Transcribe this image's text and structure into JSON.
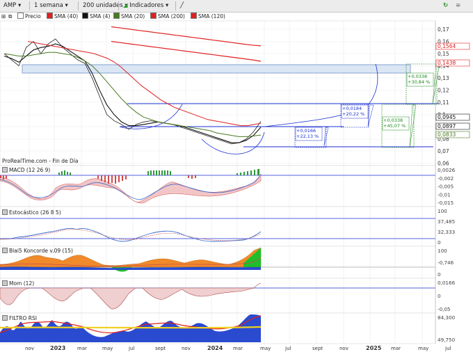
{
  "toolbar": {
    "symbol": "AMP",
    "period": "1 semana",
    "units": "200 unidades",
    "indicators": "Indicadores"
  },
  "legend": [
    {
      "label": "Precio",
      "color": "#ffffff"
    },
    {
      "label": "SMA (40)",
      "color": "#e02020"
    },
    {
      "label": "SMA (4)",
      "color": "#111111"
    },
    {
      "label": "SMA (20)",
      "color": "#4a7a20"
    },
    {
      "label": "SMA (200)",
      "color": "#e02020"
    },
    {
      "label": "SMA (120)",
      "color": "#e02020"
    }
  ],
  "watermark": "ProRealTime.com - Fin de Día",
  "price_axis": [
    "0,17",
    "0,16",
    "0,15",
    "0,14",
    "0,13",
    "0,12",
    "0,11",
    "0,1",
    "0,09",
    "0,08",
    "0,07",
    "0,06"
  ],
  "price_tags": [
    {
      "text": "0,1564",
      "color": "#e02020"
    },
    {
      "text": "0,1438",
      "color": "#e02020"
    },
    {
      "text": "0,0945",
      "color": "#111111"
    },
    {
      "text": "0,0897",
      "color": "#111111"
    },
    {
      "text": "0,0833",
      "color": "#4a7a20"
    }
  ],
  "annotations": [
    {
      "text": "+0,0166\n+22,13 %",
      "color": "#1a2fd0"
    },
    {
      "text": "+0,0184\n+20,22 %",
      "color": "#1a2fd0"
    },
    {
      "text": "+0,0338\n+45,07 %",
      "color": "#1a8a1a"
    },
    {
      "text": "+0,0338\n+30,84 %",
      "color": "#1a8a1a"
    }
  ],
  "panels": [
    {
      "title": "MACD (12 26 9)",
      "axis": [
        "0,0026",
        "-0,002",
        "-0,005",
        "-0,01",
        "-0,015"
      ]
    },
    {
      "title": "Estocástico (26 8 5)",
      "axis": [
        "100",
        "37,485",
        "32,333",
        "0"
      ]
    },
    {
      "title": "Blai5 Koncorde v.09 (15)",
      "axis": [
        "100",
        "-0,746",
        "0"
      ]
    },
    {
      "title": "Mom (12)",
      "axis": [
        "0,0166",
        "0",
        "-0,05"
      ]
    },
    {
      "title": "FILTRO RSI",
      "axis": [
        "84,300",
        "49,750"
      ]
    }
  ],
  "time_axis": [
    "nov",
    "2023",
    "mar",
    "may",
    "jul",
    "sept",
    "nov",
    "2024",
    "mar",
    "may",
    "jul",
    "sept",
    "nov",
    "2025",
    "mar",
    "may",
    "jul"
  ],
  "chart_data": {
    "type": "line",
    "title": "AMP",
    "xlabel": "",
    "ylabel": "",
    "ylim": [
      0.06,
      0.175
    ],
    "series": [
      {
        "name": "Precio",
        "values": [
          0.15,
          0.145,
          0.14,
          0.155,
          0.16,
          0.15,
          0.158,
          0.162,
          0.155,
          0.15,
          0.145,
          0.142,
          0.13,
          0.115,
          0.1,
          0.095,
          0.092,
          0.088,
          0.092,
          0.094,
          0.095,
          0.094,
          0.093,
          0.092,
          0.09,
          0.088,
          0.086,
          0.084,
          0.082,
          0.08,
          0.078,
          0.076,
          0.077,
          0.08,
          0.086,
          0.0945
        ]
      },
      {
        "name": "SMA (4)",
        "values": [
          0.148,
          0.146,
          0.143,
          0.148,
          0.153,
          0.155,
          0.156,
          0.158,
          0.156,
          0.152,
          0.148,
          0.144,
          0.134,
          0.12,
          0.108,
          0.1,
          0.094,
          0.091,
          0.091,
          0.092,
          0.093,
          0.094,
          0.093,
          0.092,
          0.091,
          0.089,
          0.087,
          0.085,
          0.083,
          0.081,
          0.079,
          0.077,
          0.077,
          0.079,
          0.083,
          0.0897
        ]
      },
      {
        "name": "SMA (20)",
        "values": [
          0.15,
          0.149,
          0.148,
          0.148,
          0.149,
          0.15,
          0.151,
          0.151,
          0.15,
          0.149,
          0.147,
          0.144,
          0.14,
          0.134,
          0.127,
          0.12,
          0.113,
          0.107,
          0.102,
          0.098,
          0.096,
          0.094,
          0.093,
          0.092,
          0.091,
          0.09,
          0.089,
          0.088,
          0.087,
          0.085,
          0.084,
          0.083,
          0.082,
          0.082,
          0.0825,
          0.0833
        ]
      },
      {
        "name": "SMA (40)",
        "values": [
          0.16,
          0.159,
          0.158,
          0.157,
          0.156,
          0.155,
          0.154,
          0.153,
          0.152,
          0.151,
          0.15,
          0.148,
          0.146,
          0.143,
          0.139,
          0.134,
          0.129,
          0.124,
          0.12,
          0.116,
          0.112,
          0.109,
          0.106,
          0.104,
          0.102,
          0.1,
          0.098,
          0.096,
          0.095,
          0.094,
          0.093,
          0.092,
          0.091,
          0.091,
          0.092,
          0.093
        ]
      },
      {
        "name": "SMA (120)",
        "values": [
          0.172,
          0.171,
          0.17,
          0.169,
          0.168,
          0.167,
          0.166,
          0.165,
          0.164,
          0.163,
          0.162,
          0.161,
          0.16,
          0.159,
          0.158,
          0.157,
          0.1564
        ]
      },
      {
        "name": "SMA (200)",
        "values": [
          0.16,
          0.159,
          0.158,
          0.157,
          0.156,
          0.155,
          0.154,
          0.153,
          0.152,
          0.151,
          0.15,
          0.149,
          0.148,
          0.147,
          0.146,
          0.145,
          0.1438
        ]
      }
    ]
  }
}
